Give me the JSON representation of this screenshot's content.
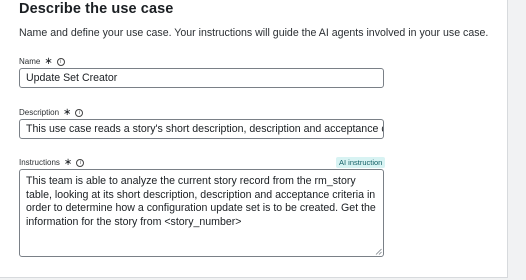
{
  "section": {
    "title": "Describe the use case",
    "subtitle": "Name and define your use case. Your instructions will guide the AI agents involved in your use case."
  },
  "fields": {
    "name": {
      "label": "Name",
      "value": "Update Set Creator"
    },
    "description": {
      "label": "Description",
      "value": "This use case reads a story's short description, description and acceptance criteria."
    },
    "instructions": {
      "label": "Instructions",
      "badge": "AI instruction",
      "value": "This team is able to analyze the current story record from the rm_story table, looking at its short description, description and acceptance criteria in order to determine how a configuration update set is to be created. Get the information for the story from <story_number>"
    }
  },
  "markers": {
    "required": "∗",
    "info": "i"
  },
  "icons": {
    "required": "asterisk-icon",
    "info": "info-icon",
    "resize": "resize-handle-icon"
  }
}
